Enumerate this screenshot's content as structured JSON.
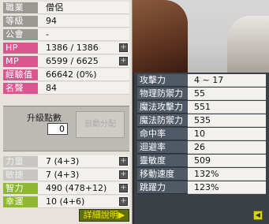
{
  "stats": [
    {
      "label": "職業",
      "value": "僧侶"
    },
    {
      "label": "等級",
      "value": "94"
    },
    {
      "label": "公會",
      "value": "-"
    },
    {
      "label": "HP",
      "value": "1386 / 1386"
    },
    {
      "label": "MP",
      "value": "6599 / 6625"
    },
    {
      "label": "經驗值",
      "value": "66642 (0%)"
    },
    {
      "label": "名聲",
      "value": "84"
    }
  ],
  "ability_points": {
    "label": "升級點數",
    "value": "0",
    "auto_label": "自動分配"
  },
  "attributes": [
    {
      "label": "力量",
      "value": "7 (4+3)"
    },
    {
      "label": "敏捷",
      "value": "7 (4+3)"
    },
    {
      "label": "智力",
      "value": "490 (478+12)"
    },
    {
      "label": "幸運",
      "value": "10 (4+6)"
    }
  ],
  "detail_button": "詳細說明▶",
  "detail_stats": [
    {
      "label": "攻擊力",
      "value": "4 ~ 17"
    },
    {
      "label": "物理防禦力",
      "value": "55"
    },
    {
      "label": "魔法攻擊力",
      "value": "551"
    },
    {
      "label": "魔法防禦力",
      "value": "535"
    },
    {
      "label": "命中率",
      "value": "10"
    },
    {
      "label": "迴避率",
      "value": "26"
    },
    {
      "label": "靈敏度",
      "value": "509"
    },
    {
      "label": "移動速度",
      "value": "132%"
    },
    {
      "label": "跳躍力",
      "value": "123%"
    }
  ],
  "back_icon": "back-arrow-icon",
  "colors": {
    "pink": "#d9568e",
    "green": "#8fb832",
    "label_gray": "#9b9893",
    "panel": "#3b4046"
  }
}
